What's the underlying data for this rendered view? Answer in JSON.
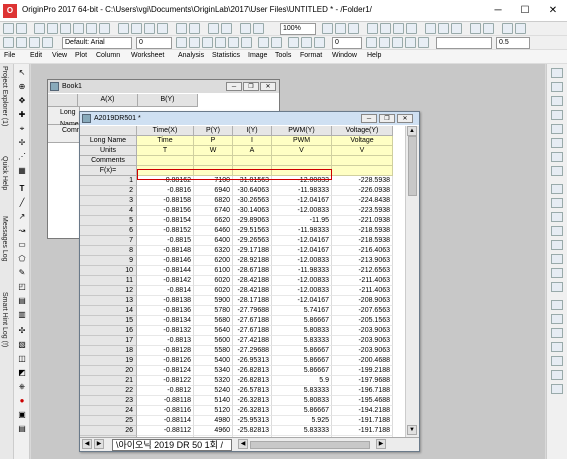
{
  "app": {
    "title": "OriginPro 2017 64-bit - C:\\Users\\vgi\\Documents\\OriginLab\\2017\\User Files\\UNTITLED * - /Folder1/",
    "icon": "origin-logo-icon",
    "controls": [
      "─",
      "☐",
      "✕"
    ]
  },
  "toolbar": {
    "zoom": "100%",
    "font": "Default: Arial",
    "font_size": "0",
    "font_size2": "0",
    "line_size": "0.5"
  },
  "menu": [
    "File",
    "Edit",
    "View",
    "Plot",
    "Column",
    "Worksheet",
    "Analysis",
    "Statistics",
    "Image",
    "Tools",
    "Format",
    "Window",
    "Help"
  ],
  "dock_tabs": [
    "Project Explorer (1)",
    "Quick Help",
    "Messages Log",
    "Smart Hint Log (!)"
  ],
  "book1": {
    "title": "Book1",
    "columns": [
      "A(X)",
      "B(Y)"
    ],
    "rows": [
      "Long Name",
      "Comments"
    ]
  },
  "worksheet": {
    "title": "A2019DR501 *",
    "columns": [
      "Time(X)",
      "P(Y)",
      "I(Y)",
      "PWM(Y)",
      "Voltage(Y)"
    ],
    "long_name": [
      "Time",
      "P",
      "I",
      "PWM",
      "Voltage"
    ],
    "units": [
      "T",
      "W",
      "A",
      "V",
      "V"
    ],
    "meta_labels": [
      "Long Name",
      "Units",
      "Comments",
      "F(x)="
    ],
    "rows": [
      [
        "1",
        "-0.88162",
        "7100",
        "-31.01563",
        "-12.00833",
        "-228.5938"
      ],
      [
        "2",
        "-0.8816",
        "6940",
        "-30.64063",
        "-11.98333",
        "-226.0938"
      ],
      [
        "3",
        "-0.88158",
        "6820",
        "-30.26563",
        "-12.04167",
        "-224.8438"
      ],
      [
        "4",
        "-0.88156",
        "6740",
        "-30.14063",
        "-12.00833",
        "-223.5938"
      ],
      [
        "5",
        "-0.88154",
        "6620",
        "-29.89063",
        "-11.95",
        "-221.0938"
      ],
      [
        "6",
        "-0.88152",
        "6460",
        "-29.51563",
        "-11.98333",
        "-218.5938"
      ],
      [
        "7",
        "-0.8815",
        "6400",
        "-29.26563",
        "-12.04167",
        "-218.5938"
      ],
      [
        "8",
        "-0.88148",
        "6320",
        "-29.17188",
        "-12.04167",
        "-216.4063"
      ],
      [
        "9",
        "-0.88146",
        "6200",
        "-28.92188",
        "-12.00833",
        "-213.9063"
      ],
      [
        "10",
        "-0.88144",
        "6100",
        "-28.67188",
        "-11.98333",
        "-212.6563"
      ],
      [
        "11",
        "-0.88142",
        "6020",
        "-28.42188",
        "-12.00833",
        "-211.4063"
      ],
      [
        "12",
        "-0.8814",
        "6020",
        "-28.42188",
        "-12.00833",
        "-211.4063"
      ],
      [
        "13",
        "-0.88138",
        "5900",
        "-28.17188",
        "-12.04167",
        "-208.9063"
      ],
      [
        "14",
        "-0.88136",
        "5780",
        "-27.79688",
        "5.74167",
        "-207.6563"
      ],
      [
        "15",
        "-0.88134",
        "5680",
        "-27.67188",
        "5.86667",
        "-205.1563"
      ],
      [
        "16",
        "-0.88132",
        "5640",
        "-27.67188",
        "5.80833",
        "-203.9063"
      ],
      [
        "17",
        "-0.8813",
        "5600",
        "-27.42188",
        "5.83333",
        "-203.9063"
      ],
      [
        "18",
        "-0.88128",
        "5580",
        "-27.29688",
        "5.86667",
        "-203.9063"
      ],
      [
        "19",
        "-0.88126",
        "5400",
        "-26.95313",
        "5.86667",
        "-200.4688"
      ],
      [
        "20",
        "-0.88124",
        "5340",
        "-26.82813",
        "5.86667",
        "-199.2188"
      ],
      [
        "21",
        "-0.88122",
        "5320",
        "-26.82813",
        "5.9",
        "-197.9688"
      ],
      [
        "22",
        "-0.8812",
        "5240",
        "-26.57813",
        "5.83333",
        "-196.7188"
      ],
      [
        "23",
        "-0.88118",
        "5140",
        "-26.32813",
        "5.80833",
        "-195.4688"
      ],
      [
        "24",
        "-0.88116",
        "5120",
        "-26.32813",
        "5.86667",
        "-194.2188"
      ],
      [
        "25",
        "-0.88114",
        "4980",
        "-25.95313",
        "5.925",
        "-191.7188"
      ],
      [
        "26",
        "-0.88112",
        "4960",
        "-25.82813",
        "5.83333",
        "-191.7188"
      ],
      [
        "27",
        "-0.8811",
        "4880",
        "-25.70313",
        "5.86667",
        "-190.4688"
      ],
      [
        "28",
        "-0.88108",
        "4780",
        "-25.32813",
        "5.83333",
        "-188.2813"
      ]
    ],
    "sheet_tab": "\\아이오닉 2019 DR 50 1회 /"
  }
}
